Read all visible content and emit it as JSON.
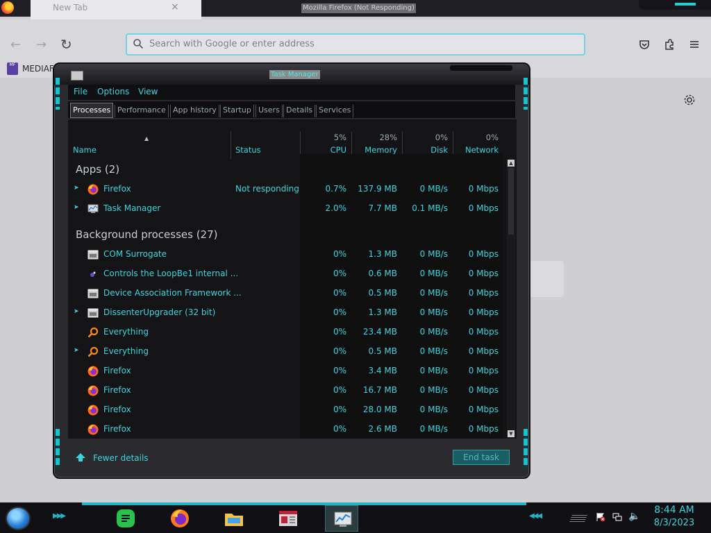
{
  "firefox": {
    "window_title": "Mozilla Firefox (Not Responding)",
    "tab_title": "New Tab",
    "tab_close": "×",
    "nav": {
      "back": "←",
      "forward": "→",
      "reload": "↻"
    },
    "urlbar_placeholder": "Search with Google or enter address",
    "bookmark_label": "MEDIAFI",
    "bookmark_icon_text": "MF"
  },
  "task_manager": {
    "title": "Task Manager",
    "menu": [
      "File",
      "Options",
      "View"
    ],
    "tabs": [
      "Processes",
      "Performance",
      "App history",
      "Startup",
      "Users",
      "Details",
      "Services"
    ],
    "columns": {
      "name": "Name",
      "status": "Status",
      "cpu": {
        "pct": "5%",
        "label": "CPU"
      },
      "memory": {
        "pct": "28%",
        "label": "Memory"
      },
      "disk": {
        "pct": "0%",
        "label": "Disk"
      },
      "network": {
        "pct": "0%",
        "label": "Network"
      }
    },
    "groups": {
      "apps": "Apps (2)",
      "background": "Background processes (27)"
    },
    "apps": [
      {
        "name": "Firefox",
        "status": "Not responding",
        "cpu": "0.7%",
        "memory": "137.9 MB",
        "disk": "0 MB/s",
        "network": "0 Mbps",
        "icon": "firefox-icon",
        "expandable": true
      },
      {
        "name": "Task Manager",
        "status": "",
        "cpu": "2.0%",
        "memory": "7.7 MB",
        "disk": "0.1 MB/s",
        "network": "0 Mbps",
        "icon": "task-manager-icon",
        "expandable": true
      }
    ],
    "background": [
      {
        "name": "COM Surrogate",
        "cpu": "0%",
        "memory": "1.3 MB",
        "disk": "0 MB/s",
        "network": "0 Mbps",
        "icon": "window-icon",
        "expandable": false
      },
      {
        "name": "Controls the LoopBe1 internal ...",
        "cpu": "0%",
        "memory": "0.6 MB",
        "disk": "0 MB/s",
        "network": "0 Mbps",
        "icon": "loopbe-icon",
        "expandable": false
      },
      {
        "name": "Device Association Framework ...",
        "cpu": "0%",
        "memory": "0.5 MB",
        "disk": "0 MB/s",
        "network": "0 Mbps",
        "icon": "window-icon",
        "expandable": false
      },
      {
        "name": "DissenterUpgrader (32 bit)",
        "cpu": "0%",
        "memory": "1.3 MB",
        "disk": "0 MB/s",
        "network": "0 Mbps",
        "icon": "window-icon",
        "expandable": true
      },
      {
        "name": "Everything",
        "cpu": "0%",
        "memory": "23.4 MB",
        "disk": "0 MB/s",
        "network": "0 Mbps",
        "icon": "magnifier-icon",
        "expandable": false
      },
      {
        "name": "Everything",
        "cpu": "0%",
        "memory": "0.5 MB",
        "disk": "0 MB/s",
        "network": "0 Mbps",
        "icon": "magnifier-icon",
        "expandable": true
      },
      {
        "name": "Firefox",
        "cpu": "0%",
        "memory": "3.4 MB",
        "disk": "0 MB/s",
        "network": "0 Mbps",
        "icon": "firefox-icon",
        "expandable": false
      },
      {
        "name": "Firefox",
        "cpu": "0%",
        "memory": "16.7 MB",
        "disk": "0 MB/s",
        "network": "0 Mbps",
        "icon": "firefox-icon",
        "expandable": false
      },
      {
        "name": "Firefox",
        "cpu": "0%",
        "memory": "28.0 MB",
        "disk": "0 MB/s",
        "network": "0 Mbps",
        "icon": "firefox-icon",
        "expandable": false
      },
      {
        "name": "Firefox",
        "cpu": "0%",
        "memory": "2.6 MB",
        "disk": "0 MB/s",
        "network": "0 Mbps",
        "icon": "firefox-icon",
        "expandable": false
      }
    ],
    "fewer_details": "Fewer details",
    "end_task": "End task"
  },
  "taskbar": {
    "apps": [
      "notes-icon",
      "firefox-icon",
      "file-explorer-icon",
      "news-icon",
      "task-manager-icon"
    ],
    "time": "8:44 AM",
    "date": "8/3/2023"
  },
  "colors": {
    "accent": "#3ad5e0",
    "window_bg": "#141416",
    "urlbar_border": "#6fd3e0"
  }
}
